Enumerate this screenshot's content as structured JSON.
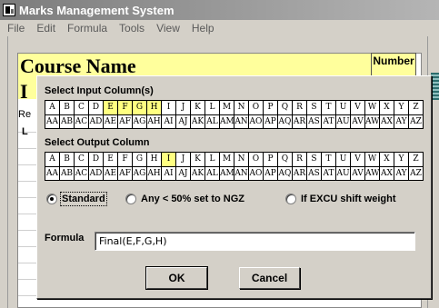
{
  "window": {
    "title": "Marks Management System"
  },
  "menu": [
    "File",
    "Edit",
    "Formula",
    "Tools",
    "View",
    "Help"
  ],
  "sheet": {
    "course_name": "Course Name",
    "big_letter": "I",
    "re_text": "Re",
    "l_text": "L",
    "number_label": "Number"
  },
  "dialog": {
    "input_label": "Select Input Column(s)",
    "input_row1": [
      "A",
      "B",
      "C",
      "D",
      "E",
      "F",
      "G",
      "H",
      "I",
      "J",
      "K",
      "L",
      "M",
      "N",
      "O",
      "P",
      "Q",
      "R",
      "S",
      "T",
      "U",
      "V",
      "W",
      "X",
      "Y",
      "Z"
    ],
    "input_row2": [
      "AA",
      "AB",
      "AC",
      "AD",
      "AE",
      "AF",
      "AG",
      "AH",
      "AI",
      "AJ",
      "AK",
      "AL",
      "AM",
      "AN",
      "AO",
      "AP",
      "AQ",
      "AR",
      "AS",
      "AT",
      "AU",
      "AV",
      "AW",
      "AX",
      "AY",
      "AZ"
    ],
    "input_selected": [
      "E",
      "F",
      "G",
      "H"
    ],
    "output_label": "Select Output Column",
    "output_row1": [
      "A",
      "B",
      "C",
      "D",
      "E",
      "F",
      "G",
      "H",
      "I",
      "J",
      "K",
      "L",
      "M",
      "N",
      "O",
      "P",
      "Q",
      "R",
      "S",
      "T",
      "U",
      "V",
      "W",
      "X",
      "Y",
      "Z"
    ],
    "output_row2": [
      "AA",
      "AB",
      "AC",
      "AD",
      "AE",
      "AF",
      "AG",
      "AH",
      "AI",
      "AJ",
      "AK",
      "AL",
      "AM",
      "AN",
      "AO",
      "AP",
      "AQ",
      "AR",
      "AS",
      "AT",
      "AU",
      "AV",
      "AW",
      "AX",
      "AY",
      "AZ"
    ],
    "output_selected": [
      "I"
    ],
    "options": [
      {
        "label": "Standard",
        "checked": true
      },
      {
        "label": "Any < 50% set to NGZ",
        "checked": false
      },
      {
        "label": "If EXCU shift weight",
        "checked": false
      }
    ],
    "formula_label": "Formula",
    "formula_value": "Final(E,F,G,H)",
    "ok_label": "OK",
    "cancel_label": "Cancel"
  },
  "colors": {
    "selected_cell": "#ffff80",
    "sheet_header": "#ffff9c"
  }
}
